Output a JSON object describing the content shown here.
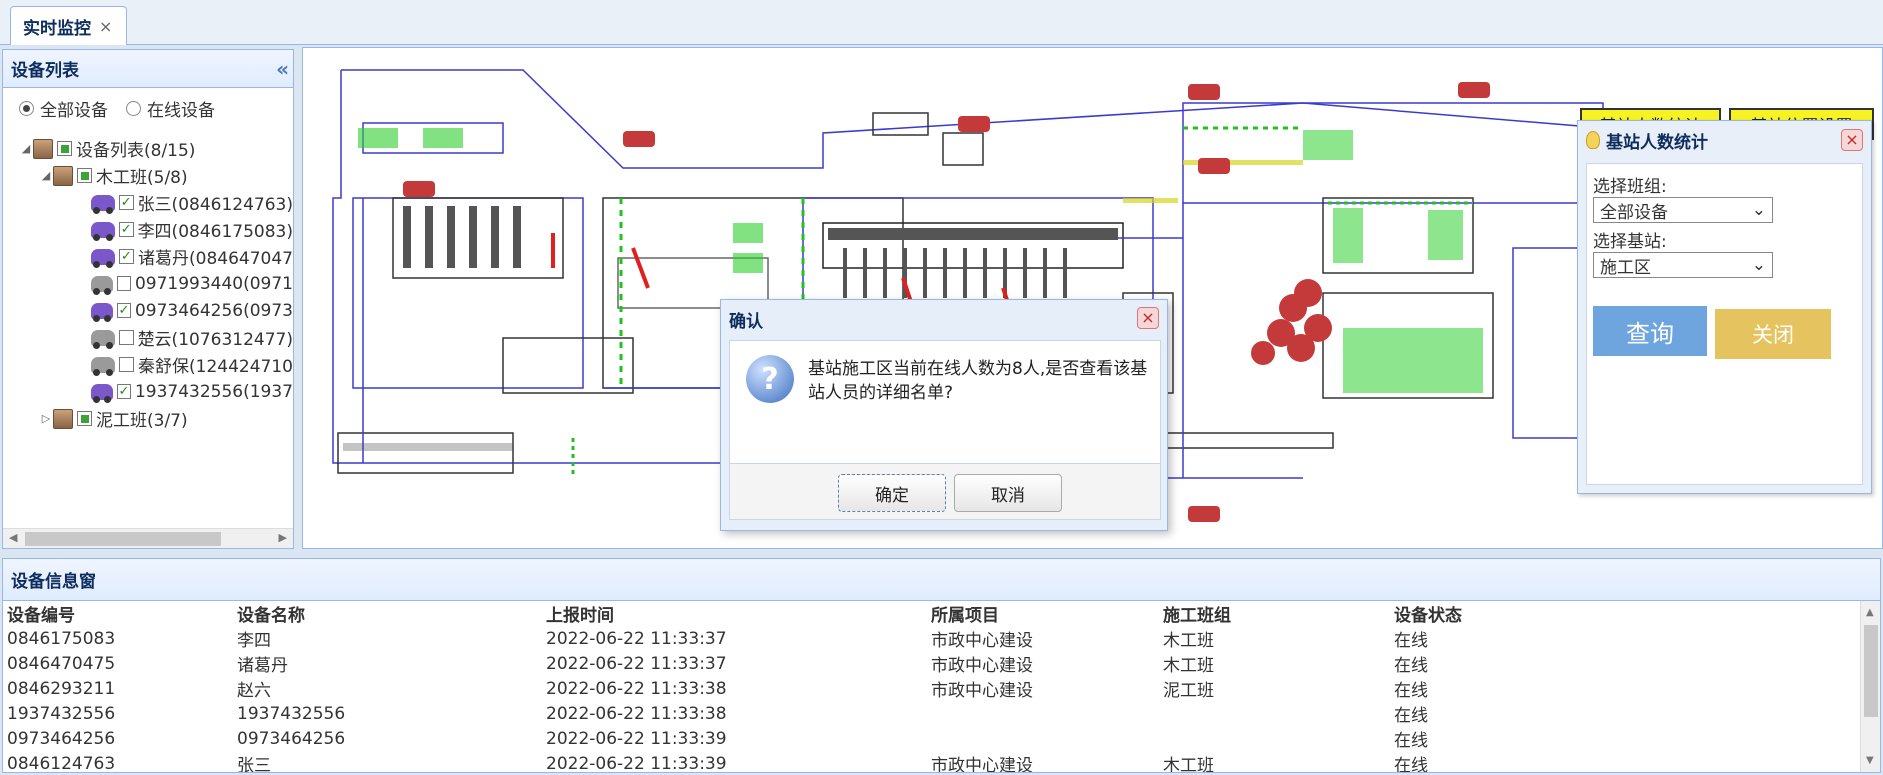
{
  "tab": {
    "label": "实时监控",
    "close": "×"
  },
  "left": {
    "title": "设备列表",
    "collapse": "«",
    "radio_all": "全部设备",
    "radio_online": "在线设备",
    "root": "设备列表(8/15)",
    "group1": "木工班(5/8)",
    "devices": [
      {
        "label": "张三(0846124763)",
        "online": true,
        "checked": true
      },
      {
        "label": "李四(0846175083)",
        "online": true,
        "checked": true
      },
      {
        "label": "诸葛丹(084647047",
        "online": true,
        "checked": true
      },
      {
        "label": "0971993440(0971",
        "online": false,
        "checked": false
      },
      {
        "label": "0973464256(0973",
        "online": true,
        "checked": true
      },
      {
        "label": "楚云(1076312477)",
        "online": false,
        "checked": false
      },
      {
        "label": "秦舒保(124424710",
        "online": false,
        "checked": false
      },
      {
        "label": "1937432556(1937",
        "online": true,
        "checked": true
      }
    ],
    "group2": "泥工班(3/7)"
  },
  "map": {
    "btn_count": "基站人数统计",
    "btn_position": "基站位置设置"
  },
  "stats": {
    "title": "基站人数统计",
    "close": "×",
    "label_group": "选择班组:",
    "group_value": "全部设备",
    "label_station": "选择基站:",
    "station_value": "施工区",
    "query": "查询",
    "close_btn": "关闭"
  },
  "dialog": {
    "title": "确认",
    "close": "×",
    "icon": "?",
    "message": "基站施工区当前在线人数为8人,是否查看该基站人员的详细名单?",
    "ok": "确定",
    "cancel": "取消"
  },
  "info": {
    "title": "设备信息窗",
    "columns": [
      "设备编号",
      "设备名称",
      "上报时间",
      "所属项目",
      "施工班组",
      "设备状态"
    ],
    "rows": [
      [
        "0846175083",
        "李四",
        "2022-06-22 11:33:37",
        "市政中心建设",
        "木工班",
        "在线"
      ],
      [
        "0846470475",
        "诸葛丹",
        "2022-06-22 11:33:37",
        "市政中心建设",
        "木工班",
        "在线"
      ],
      [
        "0846293211",
        "赵六",
        "2022-06-22 11:33:38",
        "市政中心建设",
        "泥工班",
        "在线"
      ],
      [
        "1937432556",
        "1937432556",
        "2022-06-22 11:33:38",
        "",
        "",
        "在线"
      ],
      [
        "0973464256",
        "0973464256",
        "2022-06-22 11:33:39",
        "",
        "",
        "在线"
      ],
      [
        "0846124763",
        "张三",
        "2022-06-22 11:33:39",
        "市政中心建设",
        "木工班",
        "在线"
      ]
    ]
  }
}
